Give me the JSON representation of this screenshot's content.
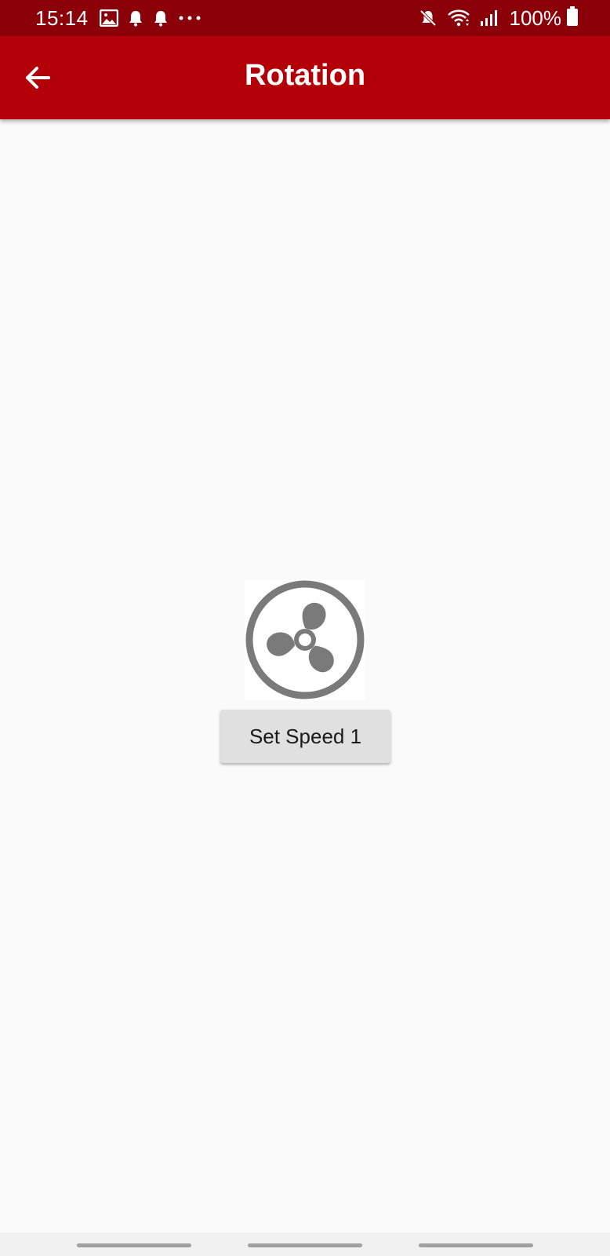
{
  "status_bar": {
    "time": "15:14",
    "battery_text": "100%",
    "icons_left": [
      "gallery-icon",
      "bell-icon",
      "bell-icon",
      "more-dots-icon"
    ],
    "icons_right": [
      "mute-icon",
      "wifi-icon",
      "signal-icon",
      "battery-icon"
    ]
  },
  "app_bar": {
    "title": "Rotation",
    "back_icon": "arrow-left-icon"
  },
  "main": {
    "fan_icon": "fan-icon",
    "speed_button_label": "Set Speed 1"
  },
  "colors": {
    "status_bar_bg": "#8b0008",
    "app_bar_bg": "#b30008",
    "page_bg": "#fafafa",
    "button_bg": "#e0e0e0",
    "fan_gray": "#7a7a7a"
  }
}
